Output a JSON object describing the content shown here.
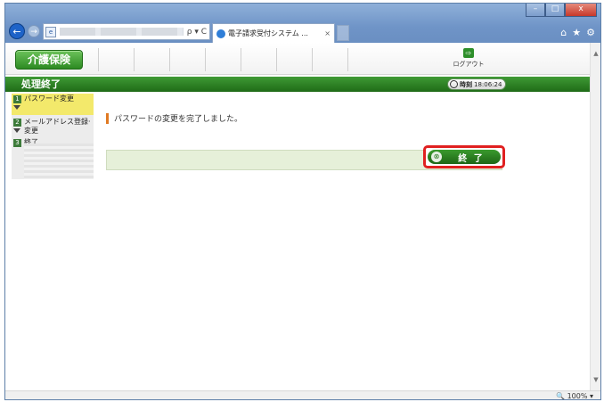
{
  "browser": {
    "tab_title": "電子請求受付システム ...",
    "tab_close": "×",
    "addr_tools": "ρ ▾ C",
    "window_controls": {
      "minimize": "–",
      "maximize": "□",
      "close": "x"
    },
    "icons": {
      "home": "⌂",
      "favorites": "★",
      "settings": "⚙"
    },
    "zoom": "100%"
  },
  "header": {
    "logo": "介護保険",
    "logout": "ログアウト"
  },
  "titlebar": {
    "title": "処理終了",
    "clock_label": "時刻",
    "clock_value": "18:06:24"
  },
  "sidebar": {
    "steps": [
      {
        "num": "1",
        "label": "パスワード変更"
      },
      {
        "num": "2",
        "label": "メールアドレス登録·変更"
      },
      {
        "num": "3",
        "label": "終了"
      }
    ]
  },
  "main": {
    "message": "パスワードの変更を完了しました。",
    "end_button": "終 了"
  },
  "colors": {
    "accent_green": "#2c8a22",
    "highlight_red": "#e02020",
    "step_active": "#f3e96b"
  }
}
